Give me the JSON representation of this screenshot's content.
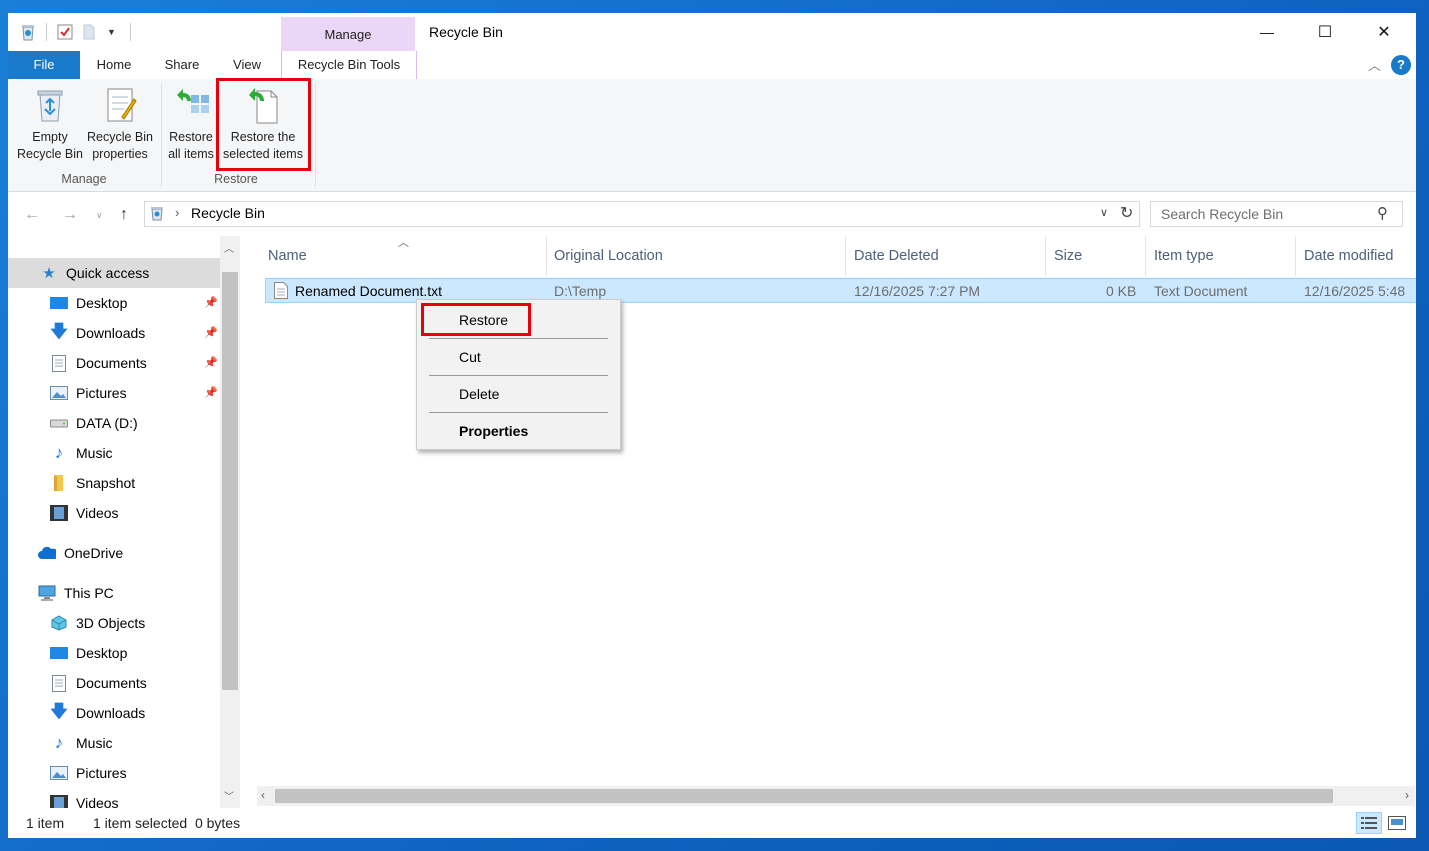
{
  "window": {
    "title": "Recycle Bin"
  },
  "titlebar": {
    "minimize_glyph": "—",
    "maximize_glyph": "☐",
    "close_glyph": "✕"
  },
  "ribbon_tabs": {
    "file": "File",
    "home": "Home",
    "share": "Share",
    "view": "View",
    "context_group": "Manage",
    "context_tab": "Recycle Bin Tools"
  },
  "ribbon": {
    "empty_bin": [
      "Empty",
      "Recycle Bin"
    ],
    "bin_properties": [
      "Recycle Bin",
      "properties"
    ],
    "manage_group": "Manage",
    "restore_all": [
      "Restore",
      "all items"
    ],
    "restore_selected": [
      "Restore the",
      "selected items"
    ],
    "restore_group": "Restore"
  },
  "address": {
    "path": "Recycle Bin",
    "search_placeholder": "Search Recycle Bin"
  },
  "nav": {
    "quick_access": "Quick access",
    "items_quick": [
      "Desktop",
      "Downloads",
      "Documents",
      "Pictures",
      "DATA (D:)",
      "Music",
      "Snapshot",
      "Videos"
    ],
    "onedrive": "OneDrive",
    "this_pc": "This PC",
    "items_pc": [
      "3D Objects",
      "Desktop",
      "Documents",
      "Downloads",
      "Music",
      "Pictures",
      "Videos"
    ]
  },
  "columns": [
    "Name",
    "Original Location",
    "Date Deleted",
    "Size",
    "Item type",
    "Date modified"
  ],
  "files": [
    {
      "name": "Renamed Document.txt",
      "original_location": "D:\\Temp",
      "date_deleted": "12/16/2025 7:27 PM",
      "size": "0 KB",
      "item_type": "Text Document",
      "date_modified": "12/16/2025 5:48"
    }
  ],
  "context_menu": {
    "restore": "Restore",
    "cut": "Cut",
    "delete": "Delete",
    "properties": "Properties"
  },
  "status": {
    "count": "1 item",
    "selected": "1 item selected  0 bytes"
  },
  "colors": {
    "accent": "#1979ca",
    "selection": "#cce8ff",
    "highlight": "#e8000b",
    "context_tab": "#ead7f7"
  }
}
